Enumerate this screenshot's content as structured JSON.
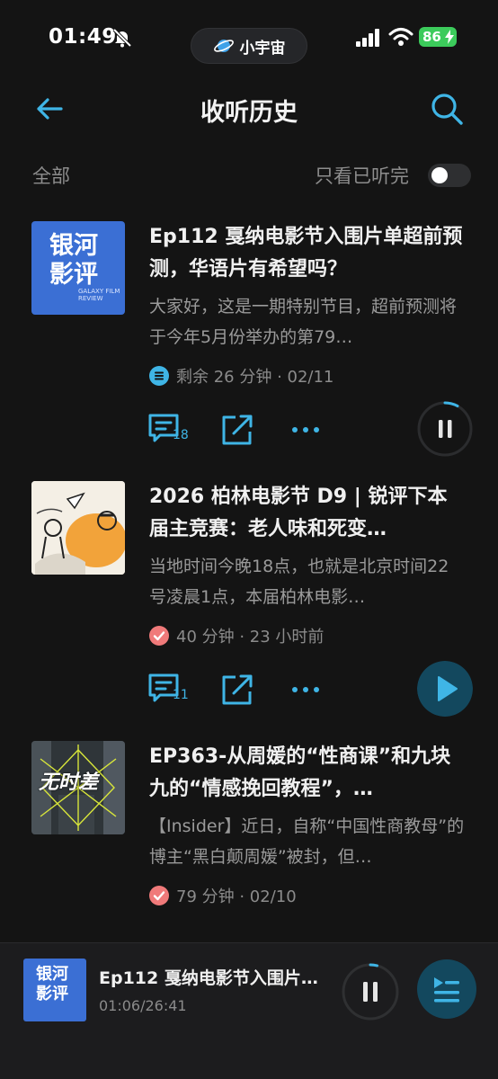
{
  "status_bar": {
    "time": "01:49",
    "pill_label": "小宇宙",
    "battery": "86"
  },
  "header": {
    "title": "收听历史"
  },
  "filters": {
    "all_label": "全部",
    "only_finished_label": "只看已听完"
  },
  "episodes": [
    {
      "cover_text_line1": "银河",
      "cover_text_line2": "影评",
      "cover_sub": "GALAXY FILM REVIEW",
      "title": "Ep112 戛纳电影节入围片单超前预测，华语片有希望吗？",
      "desc": "大家好，这是一期特别节目，超前预测将于今年5月份举办的第79…",
      "meta": "剩余 26 分钟 · 02/11",
      "status": "in-progress",
      "comments": "18",
      "playing": true,
      "progress_fraction": 0.08
    },
    {
      "title": "2026 柏林电影节 D9 | 锐评下本届主竞赛：老人味和死变…",
      "desc": "当地时间今晚18点，也就是北京时间22号凌晨1点，本届柏林电影…",
      "meta": "40 分钟 · 23 小时前",
      "status": "finished",
      "comments": "11",
      "playing": false
    },
    {
      "cover_text": "无时差",
      "title": "EP363-从周媛的“性商课”和九块九的“情感挽回教程”，…",
      "desc": "【Insider】近日，自称“中国性商教母”的博主“黑白颠周媛”被封，但…",
      "meta": "79 分钟 · 02/10",
      "status": "finished"
    }
  ],
  "player": {
    "cover_text_line1": "银河",
    "cover_text_line2": "影评",
    "title": "Ep112 戛纳电影节入围片单超前预测，华语片有希望吗？",
    "time": "01:06/26:41",
    "progress_fraction": 0.04
  },
  "colors": {
    "accent": "#3fb5e6",
    "background": "#141414",
    "check": "#f07a7a"
  }
}
